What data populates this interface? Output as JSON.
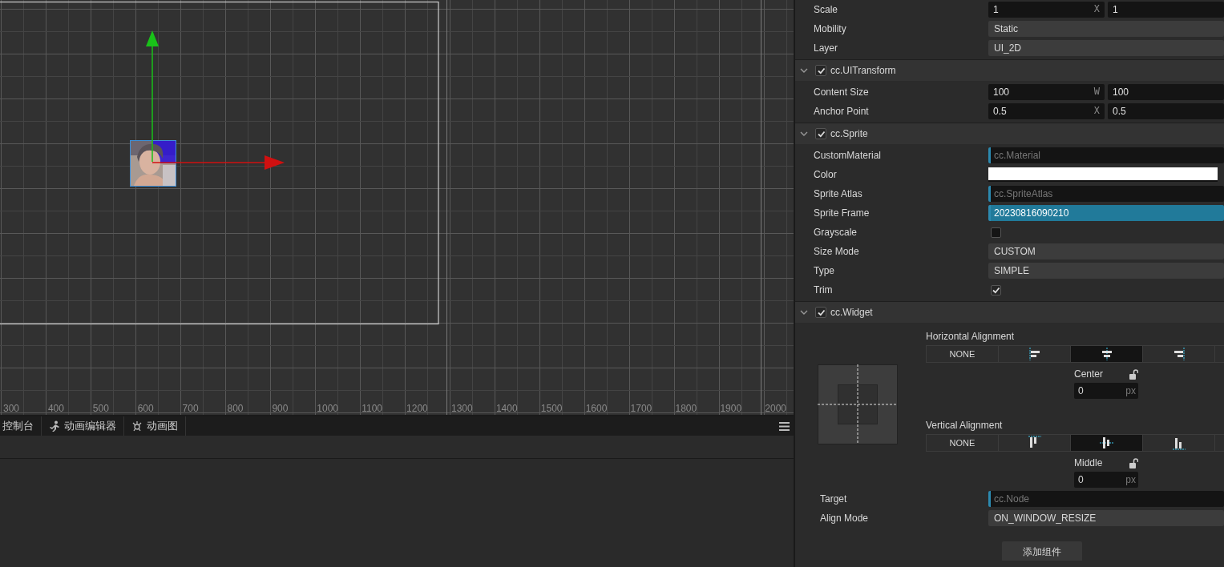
{
  "scene": {
    "ruler_labels": [
      "300",
      "400",
      "500",
      "600",
      "700",
      "800",
      "900",
      "1000",
      "1100",
      "1200",
      "1300",
      "1400",
      "1500",
      "1600",
      "1700",
      "1800",
      "1900",
      "2000"
    ]
  },
  "bottom_panel": {
    "tabs": [
      {
        "label": "控制台",
        "kind": "plain"
      },
      {
        "label": "动画编辑器",
        "kind": "runner"
      },
      {
        "label": "动画图",
        "kind": "graph"
      }
    ]
  },
  "inspector": {
    "sections": [
      {
        "rows": [
          {
            "kind": "vec2",
            "label": "Scale",
            "values": [
              {
                "value": "1",
                "axis": "X"
              },
              {
                "value": "1"
              }
            ]
          },
          {
            "kind": "select",
            "label": "Mobility",
            "value": "Static"
          },
          {
            "kind": "select",
            "label": "Layer",
            "value": "UI_2D"
          }
        ]
      },
      {
        "title": "cc.UITransform",
        "expanded": true,
        "enabled": true,
        "rows": [
          {
            "kind": "vec2",
            "label": "Content Size",
            "values": [
              {
                "value": "100",
                "axis": "W"
              },
              {
                "value": "100"
              }
            ]
          },
          {
            "kind": "vec2",
            "label": "Anchor Point",
            "values": [
              {
                "value": "0.5",
                "axis": "X"
              },
              {
                "value": "0.5"
              }
            ]
          }
        ]
      },
      {
        "title": "cc.Sprite",
        "expanded": true,
        "enabled": true,
        "rows": [
          {
            "kind": "asset",
            "label": "CustomMaterial",
            "placeholder": "cc.Material",
            "selected": false
          },
          {
            "kind": "color",
            "label": "Color",
            "color": "#ffffff"
          },
          {
            "kind": "asset",
            "label": "Sprite Atlas",
            "placeholder": "cc.SpriteAtlas",
            "selected": false
          },
          {
            "kind": "asset",
            "label": "Sprite Frame",
            "value": "20230816090210",
            "selected": true
          },
          {
            "kind": "checkbox",
            "label": "Grayscale",
            "checked": false
          },
          {
            "kind": "select",
            "label": "Size Mode",
            "value": "CUSTOM"
          },
          {
            "kind": "select",
            "label": "Type",
            "value": "SIMPLE"
          },
          {
            "kind": "checkbox",
            "label": "Trim",
            "checked": true
          }
        ]
      },
      {
        "title": "cc.Widget",
        "expanded": true,
        "enabled": true,
        "rows": [
          {
            "kind": "widget",
            "groups": [
              {
                "title": "Horizontal Alignment",
                "options": [
                  {
                    "kind": "none",
                    "label": "NONE",
                    "selected": false
                  },
                  {
                    "kind": "left",
                    "selected": false
                  },
                  {
                    "kind": "center",
                    "selected": true
                  },
                  {
                    "kind": "right",
                    "selected": false
                  }
                ],
                "field_label": "Center",
                "value": "0",
                "unit": "px"
              },
              {
                "title": "Vertical Alignment",
                "options": [
                  {
                    "kind": "none",
                    "label": "NONE",
                    "selected": false
                  },
                  {
                    "kind": "top",
                    "selected": false
                  },
                  {
                    "kind": "middle",
                    "selected": true
                  },
                  {
                    "kind": "bottom",
                    "selected": false
                  }
                ],
                "field_label": "Middle",
                "value": "0",
                "unit": "px"
              }
            ]
          },
          {
            "kind": "asset",
            "label": "Target",
            "placeholder": "cc.Node",
            "selected": false
          },
          {
            "kind": "select",
            "label": "Align Mode",
            "value": "ON_WINDOW_RESIZE"
          }
        ]
      }
    ],
    "add_button": "添加组件"
  }
}
